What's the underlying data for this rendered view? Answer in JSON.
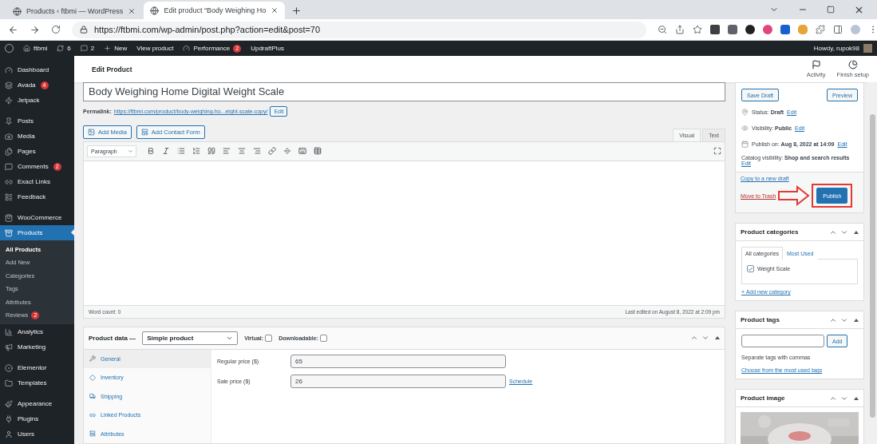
{
  "browser": {
    "tabs": [
      {
        "title": "Products ‹ ftbmi — WordPress",
        "selected": false
      },
      {
        "title": "Edit product “Body Weighing Ho",
        "selected": true
      }
    ],
    "url": "https://ftbmi.com/wp-admin/post.php?action=edit&post=70"
  },
  "admin_bar": {
    "items": [
      {
        "kind": "site",
        "label": "ftbmi"
      },
      {
        "kind": "updates",
        "label": "6"
      },
      {
        "kind": "comments",
        "label": "2"
      },
      {
        "kind": "new",
        "label": "New"
      },
      {
        "kind": "link",
        "label": "View product"
      },
      {
        "kind": "performance",
        "label": "Performance",
        "badge": "2"
      },
      {
        "kind": "link",
        "label": "UpdraftPlus"
      }
    ],
    "greeting": "Howdy, rupok98"
  },
  "sidebar": {
    "groups": [
      {
        "items": [
          {
            "label": "Dashboard",
            "selected": false
          },
          {
            "label": "Avada",
            "selected": false,
            "badge": "4"
          },
          {
            "label": "Jetpack",
            "selected": false
          }
        ]
      },
      {
        "items": [
          {
            "label": "Posts",
            "selected": false
          },
          {
            "label": "Media",
            "selected": false
          },
          {
            "label": "Pages",
            "selected": false
          },
          {
            "label": "Comments",
            "selected": false,
            "badge": "2"
          },
          {
            "label": "Exact Links",
            "selected": false
          },
          {
            "label": "Feedback",
            "selected": false
          }
        ]
      },
      {
        "items": [
          {
            "label": "WooCommerce",
            "selected": false
          },
          {
            "label": "Products",
            "selected": true,
            "children": [
              {
                "label": "All Products",
                "selected": true
              },
              {
                "label": "Add New",
                "selected": false
              },
              {
                "label": "Categories",
                "selected": false
              },
              {
                "label": "Tags",
                "selected": false
              },
              {
                "label": "Attributes",
                "selected": false
              },
              {
                "label": "Reviews",
                "selected": false,
                "badge": "2"
              }
            ]
          },
          {
            "label": "Analytics",
            "selected": false
          },
          {
            "label": "Marketing",
            "selected": false
          }
        ]
      },
      {
        "items": [
          {
            "label": "Elementor",
            "selected": false
          },
          {
            "label": "Templates",
            "selected": false
          }
        ]
      },
      {
        "items": [
          {
            "label": "Appearance",
            "selected": false
          },
          {
            "label": "Plugins",
            "selected": false
          },
          {
            "label": "Users",
            "selected": false
          }
        ]
      }
    ]
  },
  "header": {
    "title": "Edit Product",
    "actions": [
      "Activity",
      "Finish setup"
    ]
  },
  "editor": {
    "title": "Body Weighing Home Digital Weight Scale",
    "permalink_label": "Permalink:",
    "permalink_url": "https://ftbmi.com/product/body-weighing-ho...eight-scale-copy/",
    "permalink_button": "Edit",
    "media_buttons": [
      "Add Media",
      "Add Contact Form"
    ],
    "mode_tabs": [
      {
        "label": "Visual",
        "selected": true
      },
      {
        "label": "Text",
        "selected": false
      }
    ],
    "format": "Paragraph",
    "word_count": "Word count: 0",
    "last_edited": "Last edited on August 8, 2022 at 2:09 pm"
  },
  "product_data": {
    "label": "Product data —",
    "type": "Simple product",
    "options": [
      {
        "label": "Virtual:",
        "checked": false
      },
      {
        "label": "Downloadable:",
        "checked": false
      }
    ],
    "tabs": [
      {
        "label": "General",
        "selected": true
      },
      {
        "label": "Inventory",
        "selected": false
      },
      {
        "label": "Shipping",
        "selected": false
      },
      {
        "label": "Linked Products",
        "selected": false
      },
      {
        "label": "Attributes",
        "selected": false
      }
    ],
    "fields": [
      {
        "label": "Regular price ($)",
        "value": "65"
      },
      {
        "label": "Sale price ($)",
        "value": "26",
        "link": "Schedule"
      }
    ]
  },
  "publish": {
    "buttons": [
      "Save Draft",
      "Preview"
    ],
    "meta": [
      {
        "text": "Status: **Draft**",
        "link": "Edit"
      },
      {
        "text": "Visibility: **Public**",
        "link": "Edit"
      },
      {
        "text": "Publish on: **Aug 8, 2022 at 14:09**",
        "link": "Edit"
      }
    ],
    "catalog": {
      "text": "Catalog visibility: **Shop and search results**",
      "link": "Edit"
    },
    "copy_link": "Copy to a new draft",
    "trash_link": "Move to Trash",
    "publish_button": "Publish"
  },
  "categories": {
    "title": "Product categories",
    "tabs": [
      {
        "label": "All categories",
        "selected": true
      },
      {
        "label": "Most Used",
        "selected": false
      }
    ],
    "items": [
      {
        "label": "Weight Scale",
        "checked": true
      }
    ],
    "add_link": "+ Add new category"
  },
  "tags": {
    "title": "Product tags",
    "button": "Add",
    "hint": "Separate tags with commas",
    "link": "Choose from the most used tags"
  },
  "image": {
    "title": "Product image",
    "kind": "picture"
  }
}
